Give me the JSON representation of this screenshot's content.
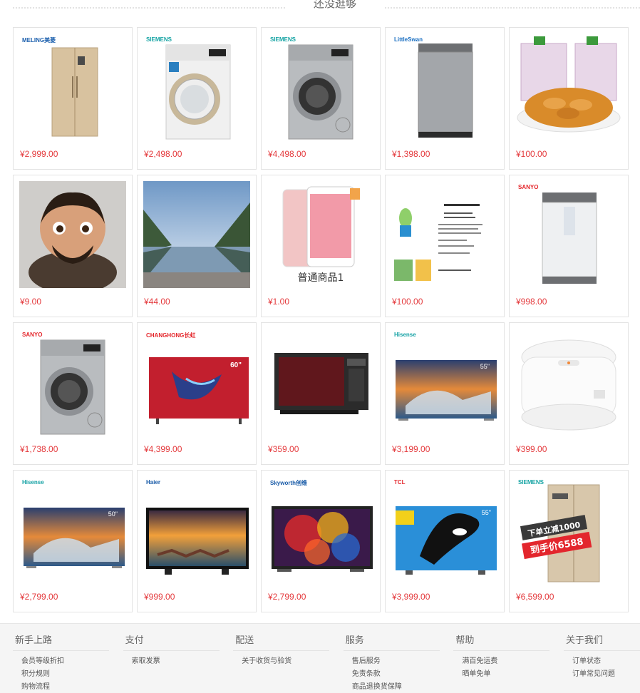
{
  "section": {
    "title": "还没逛够"
  },
  "products": [
    {
      "price": "¥2,999.00",
      "brand": "MELING美菱",
      "brand_color": "#1b5fad",
      "kind": "fridge-gold"
    },
    {
      "price": "¥2,498.00",
      "brand": "SIEMENS",
      "brand_color": "#14a3a3",
      "kind": "washer-white"
    },
    {
      "price": "¥4,498.00",
      "brand": "SIEMENS",
      "brand_color": "#14a3a3",
      "kind": "washer-silver"
    },
    {
      "price": "¥1,398.00",
      "brand": "LittleSwan",
      "brand_color": "#1a6fc2",
      "kind": "washer-top"
    },
    {
      "price": "¥100.00",
      "brand": "",
      "brand_color": "#000",
      "kind": "snack"
    },
    {
      "price": "¥9.00",
      "brand": "",
      "brand_color": "#000",
      "kind": "figure"
    },
    {
      "price": "¥44.00",
      "brand": "",
      "brand_color": "#000",
      "kind": "lake"
    },
    {
      "price": "¥1.00",
      "brand": "",
      "brand_color": "#000",
      "kind": "phone",
      "caption": "普通商品1"
    },
    {
      "price": "¥100.00",
      "brand": "",
      "brand_color": "#000",
      "kind": "doc"
    },
    {
      "price": "¥998.00",
      "brand": "SANYO",
      "brand_color": "#e4262b",
      "kind": "washer-top-white"
    },
    {
      "price": "¥1,738.00",
      "brand": "SANYO",
      "brand_color": "#e4262b",
      "kind": "washer-silver"
    },
    {
      "price": "¥4,399.00",
      "brand": "CHANGHONG长虹",
      "brand_color": "#e4262b",
      "kind": "tv-red",
      "badge": "60\""
    },
    {
      "price": "¥359.00",
      "brand": "",
      "brand_color": "#000",
      "kind": "microwave"
    },
    {
      "price": "¥3,199.00",
      "brand": "Hisense",
      "brand_color": "#17a3a6",
      "kind": "tv-city",
      "badge": "55\""
    },
    {
      "price": "¥399.00",
      "brand": "",
      "brand_color": "#000",
      "kind": "cooker"
    },
    {
      "price": "¥2,799.00",
      "brand": "Hisense",
      "brand_color": "#17a3a6",
      "kind": "tv-city",
      "badge": "50\""
    },
    {
      "price": "¥999.00",
      "brand": "Haier",
      "brand_color": "#1a5ca8",
      "kind": "tv-sunset"
    },
    {
      "price": "¥2,799.00",
      "brand": "Skyworth创维",
      "brand_color": "#1a5ca8",
      "kind": "tv-paint"
    },
    {
      "price": "¥3,999.00",
      "brand": "TCL",
      "brand_color": "#e4262b",
      "kind": "tv-whale",
      "badge": "55\""
    },
    {
      "price": "¥6,599.00",
      "brand": "SIEMENS",
      "brand_color": "#14a3a3",
      "kind": "fridge-promo",
      "promo1": "下单立减1000",
      "promo2": "到手价6588"
    }
  ],
  "footer": {
    "columns": [
      {
        "title": "新手上路",
        "items": [
          "会员等级折扣",
          "积分规则",
          "购物流程"
        ]
      },
      {
        "title": "支付",
        "items": [
          "索取发票"
        ]
      },
      {
        "title": "配送",
        "items": [
          "关于收货与验货"
        ]
      },
      {
        "title": "服务",
        "items": [
          "售后服务",
          "免责条款",
          "商品退换货保障"
        ]
      },
      {
        "title": "帮助",
        "items": [
          "满百免运费",
          "晒单免单"
        ]
      },
      {
        "title": "关于我们",
        "items": [
          "订单状态",
          "订单常见问题"
        ]
      }
    ]
  }
}
